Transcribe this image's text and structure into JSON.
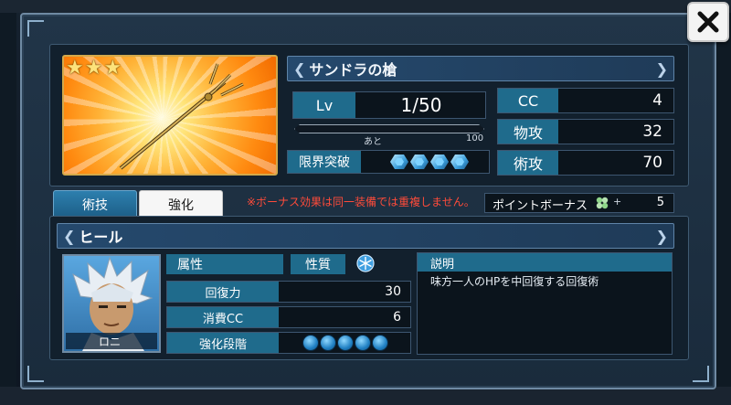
{
  "colors": {
    "frame_border": "#6f8aa3",
    "label_fill": "#1f6b8c",
    "warning_text": "#ff4b3a",
    "card_glow": "#ffb236",
    "tab_active": "#2d7fae"
  },
  "close_button": {
    "icon": "close-icon"
  },
  "weapon": {
    "stars": [
      "★",
      "★",
      "★"
    ],
    "name": "サンドラの槍",
    "level_label": "Lv",
    "level_value": "1/50",
    "exp_prefix": "あと",
    "exp_remaining": "100",
    "exp_progress": 0.0,
    "limit_break_label": "限界突破",
    "limit_break_gems": 4,
    "stats": [
      {
        "label": "CC",
        "value": "4"
      },
      {
        "label": "物攻",
        "value": "32"
      },
      {
        "label": "術攻",
        "value": "70"
      }
    ]
  },
  "tabs": [
    {
      "label": "術技",
      "active": true
    },
    {
      "label": "強化",
      "active": false
    }
  ],
  "warning": "※ボーナス効果は同一装備では重複しません。",
  "point_bonus": {
    "label": "ポイントボーナス",
    "plus": "+",
    "value": "5",
    "icon": "clover-icon"
  },
  "skill": {
    "name": "ヒール",
    "character_name": "ロニ",
    "attribute_label": "属性",
    "nature_label": "性質",
    "nature_icon": "snowflake-icon",
    "rows": [
      {
        "label": "回復力",
        "value": "30"
      },
      {
        "label": "消費CC",
        "value": "6"
      },
      {
        "label": "強化段階",
        "value": ""
      }
    ],
    "enhancement_orbs": 5,
    "description_label": "説明",
    "description": "味方一人のHPを中回復する回復術"
  }
}
